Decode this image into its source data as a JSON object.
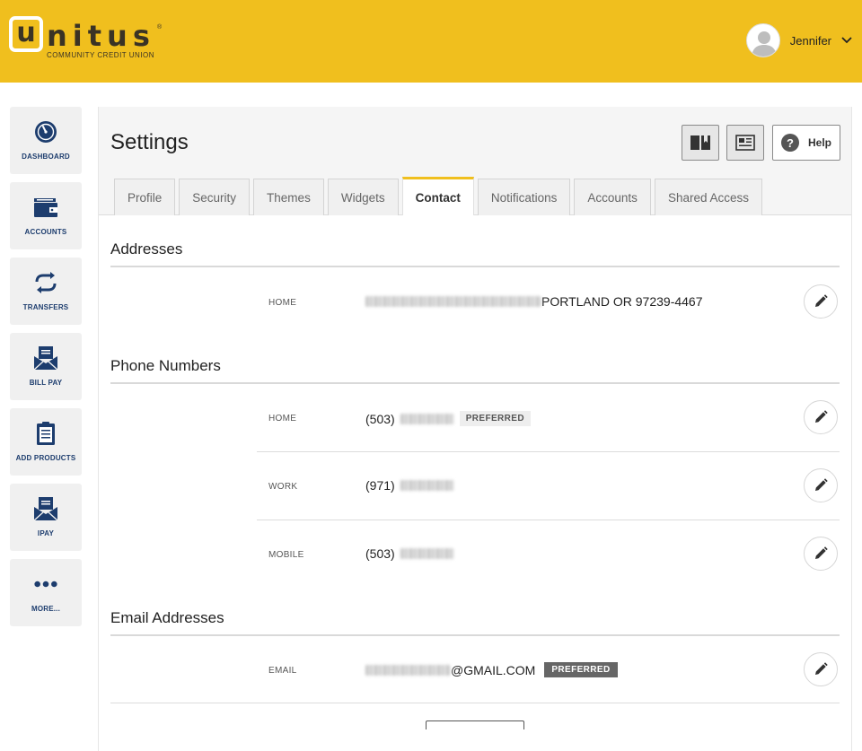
{
  "header": {
    "logo": {
      "word_first": "u",
      "word_rest": "nitus",
      "registered": "®",
      "subtitle": "COMMUNITY CREDIT UNION"
    },
    "user": {
      "name": "Jennifer"
    }
  },
  "sidebar": {
    "items": [
      {
        "label": "DASHBOARD",
        "icon": "gauge-icon"
      },
      {
        "label": "ACCOUNTS",
        "icon": "wallet-icon"
      },
      {
        "label": "TRANSFERS",
        "icon": "transfer-arrows-icon"
      },
      {
        "label": "BILL PAY",
        "icon": "envelope-icon"
      },
      {
        "label": "ADD PRODUCTS",
        "icon": "clipboard-icon"
      },
      {
        "label": "IPAY",
        "icon": "envelope-icon"
      },
      {
        "label": "MORE...",
        "icon": "dots-icon"
      }
    ]
  },
  "page": {
    "title": "Settings",
    "help_label": "Help",
    "help_glyph": "?"
  },
  "tabs": [
    {
      "label": "Profile",
      "active": false
    },
    {
      "label": "Security",
      "active": false
    },
    {
      "label": "Themes",
      "active": false
    },
    {
      "label": "Widgets",
      "active": false
    },
    {
      "label": "Contact",
      "active": true
    },
    {
      "label": "Notifications",
      "active": false
    },
    {
      "label": "Accounts",
      "active": false
    },
    {
      "label": "Shared Access",
      "active": false
    }
  ],
  "addresses": {
    "title": "Addresses",
    "rows": [
      {
        "label": "HOME",
        "value_suffix": "PORTLAND OR 97239-4467"
      }
    ]
  },
  "phones": {
    "title": "Phone Numbers",
    "rows": [
      {
        "label": "HOME",
        "area": "(503)",
        "badge": "PREFERRED"
      },
      {
        "label": "WORK",
        "area": "(971)"
      },
      {
        "label": "MOBILE",
        "area": "(503)"
      }
    ]
  },
  "emails": {
    "title": "Email Addresses",
    "rows": [
      {
        "label": "EMAIL",
        "value_suffix": "@GMAIL.COM",
        "badge": "PREFERRED"
      }
    ]
  },
  "colors": {
    "brand_yellow": "#f0bf1e",
    "nav_blue": "#1d3d6e"
  }
}
